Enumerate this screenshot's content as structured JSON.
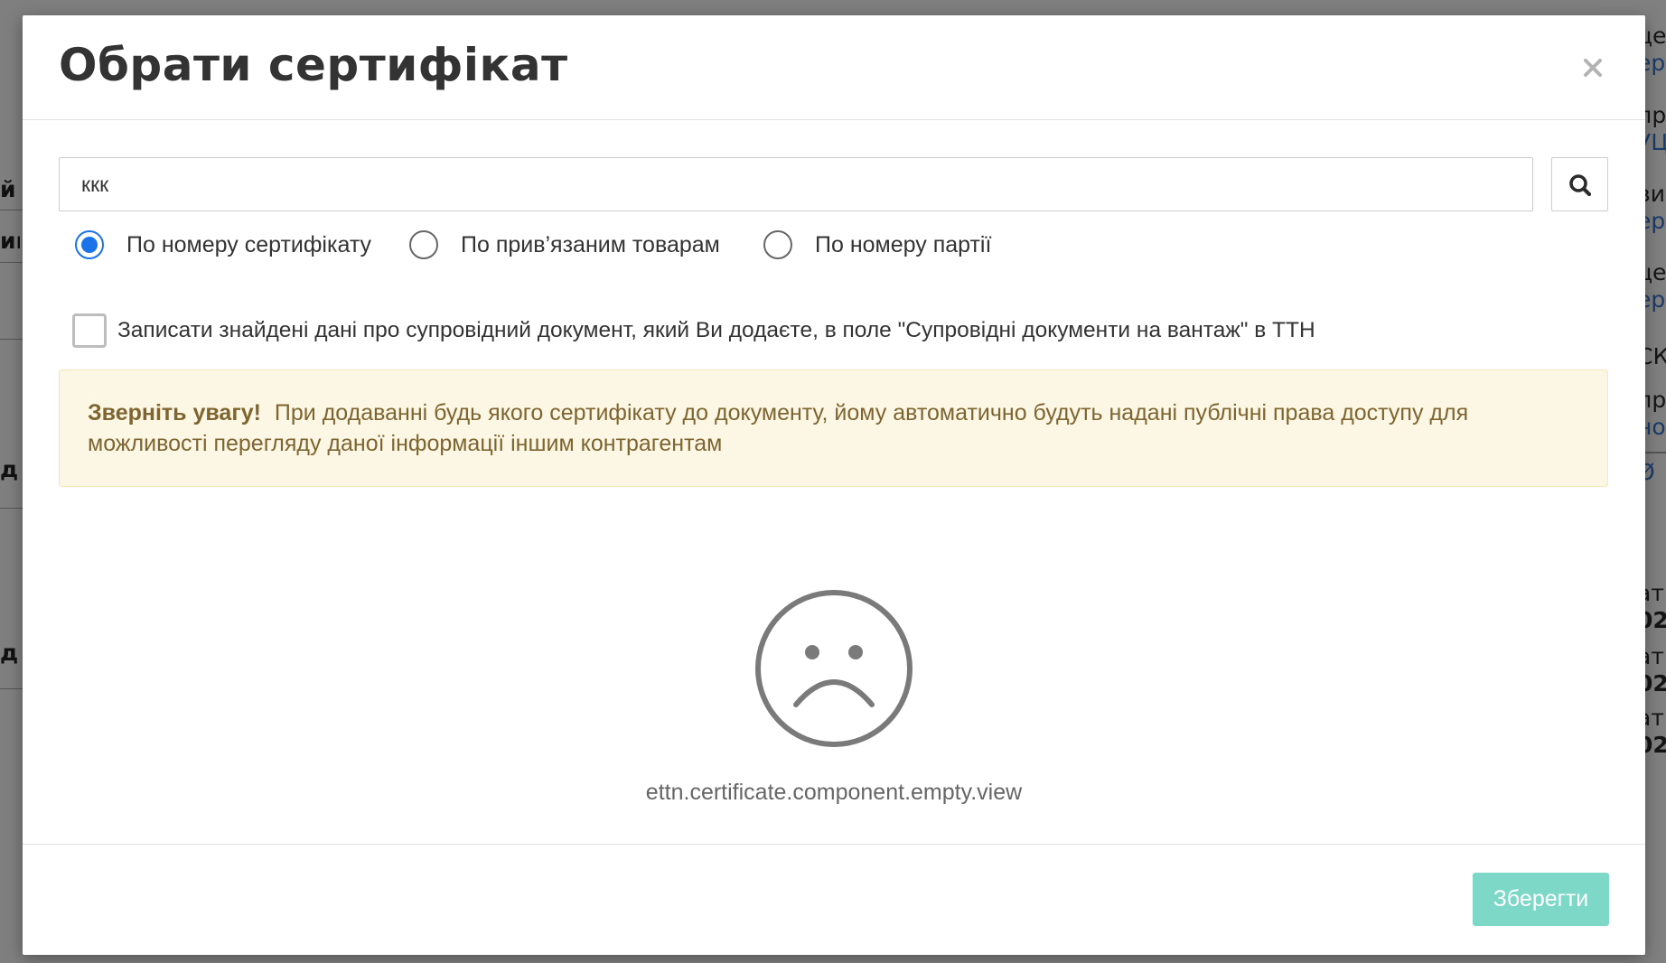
{
  "dialog": {
    "title": "Обрати сертифікат",
    "close_label": "×",
    "search": {
      "value": "ккк",
      "placeholder": ""
    },
    "search_modes": [
      {
        "label": "По номеру сертифікату",
        "selected": true
      },
      {
        "label": "По прив’язаним товарам",
        "selected": false
      },
      {
        "label": "По номеру партії",
        "selected": false
      }
    ],
    "write_to_ttn_checkbox": {
      "label": "Записати знайдені дані про супровідний документ, який Ви додаєте, в поле \"Супровідні документи на вантаж\" в ТТН",
      "checked": false
    },
    "warning": {
      "strong": "Зверніть увагу!",
      "text": "При додаванні будь якого сертифікату до документу, йому автоматично будуть надані публічні права доступу для можливості перегляду даної інформації іншим контрагентам"
    },
    "empty_state": {
      "icon": "sad-face-icon",
      "text": "ettn.certificate.component.empty.view"
    },
    "save_label": "Зберегти"
  },
  "colors": {
    "radio_selected": "#1a73e8",
    "save_button": "#7dd8c7",
    "warning_bg": "#fcf6e5",
    "warning_text": "#7e6530",
    "title_text": "#333333",
    "overlay": "#7f7f7f"
  }
}
